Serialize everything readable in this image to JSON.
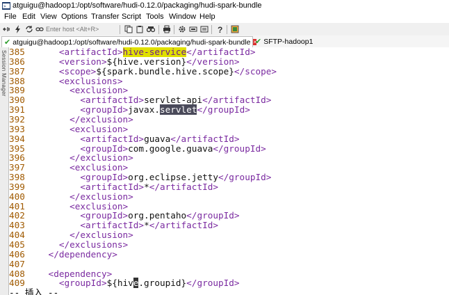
{
  "window": {
    "title": "atguigu@hadoop1:/opt/software/hudi-0.12.0/packaging/hudi-spark-bundle"
  },
  "menu": [
    "File",
    "Edit",
    "View",
    "Options",
    "Transfer",
    "Script",
    "Tools",
    "Window",
    "Help"
  ],
  "toolbar": {
    "host_placeholder": "Enter host <Alt+R>"
  },
  "tabs": [
    {
      "label": "atguigu@hadoop1:/opt/software/hudi-0.12.0/packaging/hudi-spark-bundle",
      "active": true
    },
    {
      "label": "SFTP-hadoop1",
      "active": false
    }
  ],
  "side_panel": {
    "label": "Session Manager"
  },
  "editor": {
    "lines": [
      {
        "num": "385",
        "segs": [
          {
            "t": "      <artifactId>",
            "c": "tag"
          },
          {
            "t": "hive-service",
            "c": "hl"
          },
          {
            "t": "</artifactId>",
            "c": "tag"
          }
        ]
      },
      {
        "num": "386",
        "segs": [
          {
            "t": "      <version>",
            "c": "tag"
          },
          {
            "t": "${hive.version}",
            "c": "txt"
          },
          {
            "t": "</version>",
            "c": "tag"
          }
        ]
      },
      {
        "num": "387",
        "segs": [
          {
            "t": "      <scope>",
            "c": "tag"
          },
          {
            "t": "${spark.bundle.hive.scope}",
            "c": "txt"
          },
          {
            "t": "</scope>",
            "c": "tag"
          }
        ]
      },
      {
        "num": "388",
        "segs": [
          {
            "t": "      <exclusions>",
            "c": "tag"
          }
        ]
      },
      {
        "num": "389",
        "segs": [
          {
            "t": "        <exclusion>",
            "c": "tag"
          }
        ]
      },
      {
        "num": "390",
        "segs": [
          {
            "t": "          <artifactId>",
            "c": "tag"
          },
          {
            "t": "servlet-api",
            "c": "txt"
          },
          {
            "t": "</artifactId>",
            "c": "tag"
          }
        ]
      },
      {
        "num": "391",
        "segs": [
          {
            "t": "          <groupId>",
            "c": "tag"
          },
          {
            "t": "javax.",
            "c": "txt"
          },
          {
            "t": "servlet",
            "c": "sel"
          },
          {
            "t": "</groupId>",
            "c": "tag"
          }
        ]
      },
      {
        "num": "392",
        "segs": [
          {
            "t": "        </exclusion>",
            "c": "tag"
          }
        ]
      },
      {
        "num": "393",
        "segs": [
          {
            "t": "        <exclusion>",
            "c": "tag"
          }
        ]
      },
      {
        "num": "394",
        "segs": [
          {
            "t": "          <artifactId>",
            "c": "tag"
          },
          {
            "t": "guava",
            "c": "txt"
          },
          {
            "t": "</artifactId>",
            "c": "tag"
          }
        ]
      },
      {
        "num": "395",
        "segs": [
          {
            "t": "          <groupId>",
            "c": "tag"
          },
          {
            "t": "com.google.guava",
            "c": "txt"
          },
          {
            "t": "</groupId>",
            "c": "tag"
          }
        ]
      },
      {
        "num": "396",
        "segs": [
          {
            "t": "        </exclusion>",
            "c": "tag"
          }
        ]
      },
      {
        "num": "397",
        "segs": [
          {
            "t": "        <exclusion>",
            "c": "tag"
          }
        ]
      },
      {
        "num": "398",
        "segs": [
          {
            "t": "          <groupId>",
            "c": "tag"
          },
          {
            "t": "org.eclipse.jetty",
            "c": "txt"
          },
          {
            "t": "</groupId>",
            "c": "tag"
          }
        ]
      },
      {
        "num": "399",
        "segs": [
          {
            "t": "          <artifactId>",
            "c": "tag"
          },
          {
            "t": "*",
            "c": "txt"
          },
          {
            "t": "</artifactId>",
            "c": "tag"
          }
        ]
      },
      {
        "num": "400",
        "segs": [
          {
            "t": "        </exclusion>",
            "c": "tag"
          }
        ]
      },
      {
        "num": "401",
        "segs": [
          {
            "t": "        <exclusion>",
            "c": "tag"
          }
        ]
      },
      {
        "num": "402",
        "segs": [
          {
            "t": "          <groupId>",
            "c": "tag"
          },
          {
            "t": "org.pentaho",
            "c": "txt"
          },
          {
            "t": "</groupId>",
            "c": "tag"
          }
        ]
      },
      {
        "num": "403",
        "segs": [
          {
            "t": "          <artifactId>",
            "c": "tag"
          },
          {
            "t": "*",
            "c": "txt"
          },
          {
            "t": "</artifactId>",
            "c": "tag"
          }
        ]
      },
      {
        "num": "404",
        "segs": [
          {
            "t": "        </exclusion>",
            "c": "tag"
          }
        ]
      },
      {
        "num": "405",
        "segs": [
          {
            "t": "      </exclusions>",
            "c": "tag"
          }
        ]
      },
      {
        "num": "406",
        "segs": [
          {
            "t": "    </dependency>",
            "c": "tag"
          }
        ]
      },
      {
        "num": "407",
        "segs": []
      },
      {
        "num": "408",
        "segs": [
          {
            "t": "    <dependency>",
            "c": "tag"
          }
        ]
      },
      {
        "num": "409",
        "segs": [
          {
            "t": "      <groupId>",
            "c": "tag"
          },
          {
            "t": "${hiv",
            "c": "txt"
          },
          {
            "t": "e",
            "c": "cursor"
          },
          {
            "t": ".groupid}",
            "c": "txt"
          },
          {
            "t": "</groupId>",
            "c": "tag"
          }
        ]
      }
    ],
    "status": "-- 插入 --"
  },
  "colors": {
    "tag": "#7a2aa0",
    "line_number": "#a05a00",
    "search_highlight": "#e0e000",
    "selection": "#4a4a5a"
  }
}
